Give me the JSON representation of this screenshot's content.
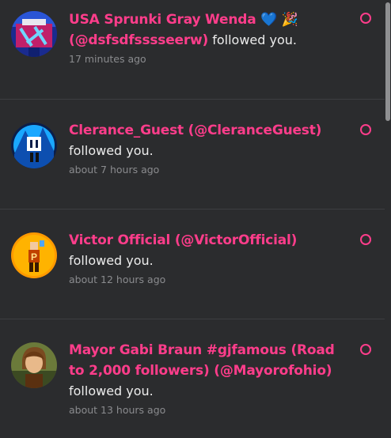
{
  "notifications": [
    {
      "name": "USA Sprunki Gray Wenda",
      "emoji": "💙 🎉",
      "handle": "(@dsfsdfsssseerw)",
      "action": "followed you.",
      "time": "17 minutes ago",
      "avatar_icon": "sprunki-avatar"
    },
    {
      "name": "Clerance_Guest (@CleranceGuest)",
      "action": "followed you.",
      "time": "about 7 hours ago",
      "avatar_icon": "guest-avatar"
    },
    {
      "name": "Victor Official (@VictorOfficial)",
      "action": "followed you.",
      "time": "about 12 hours ago",
      "avatar_icon": "victor-avatar"
    },
    {
      "name": "Mayor Gabi Braun #gjfamous (Road to 2,000 followers) (@Mayorofohio)",
      "action": "followed you.",
      "time": "about 13 hours ago",
      "avatar_icon": "mayor-avatar"
    }
  ],
  "colors": {
    "accent": "#ff3d8b",
    "background": "#2b2c2e",
    "text": "#ececec",
    "muted": "#8a8b8e"
  }
}
